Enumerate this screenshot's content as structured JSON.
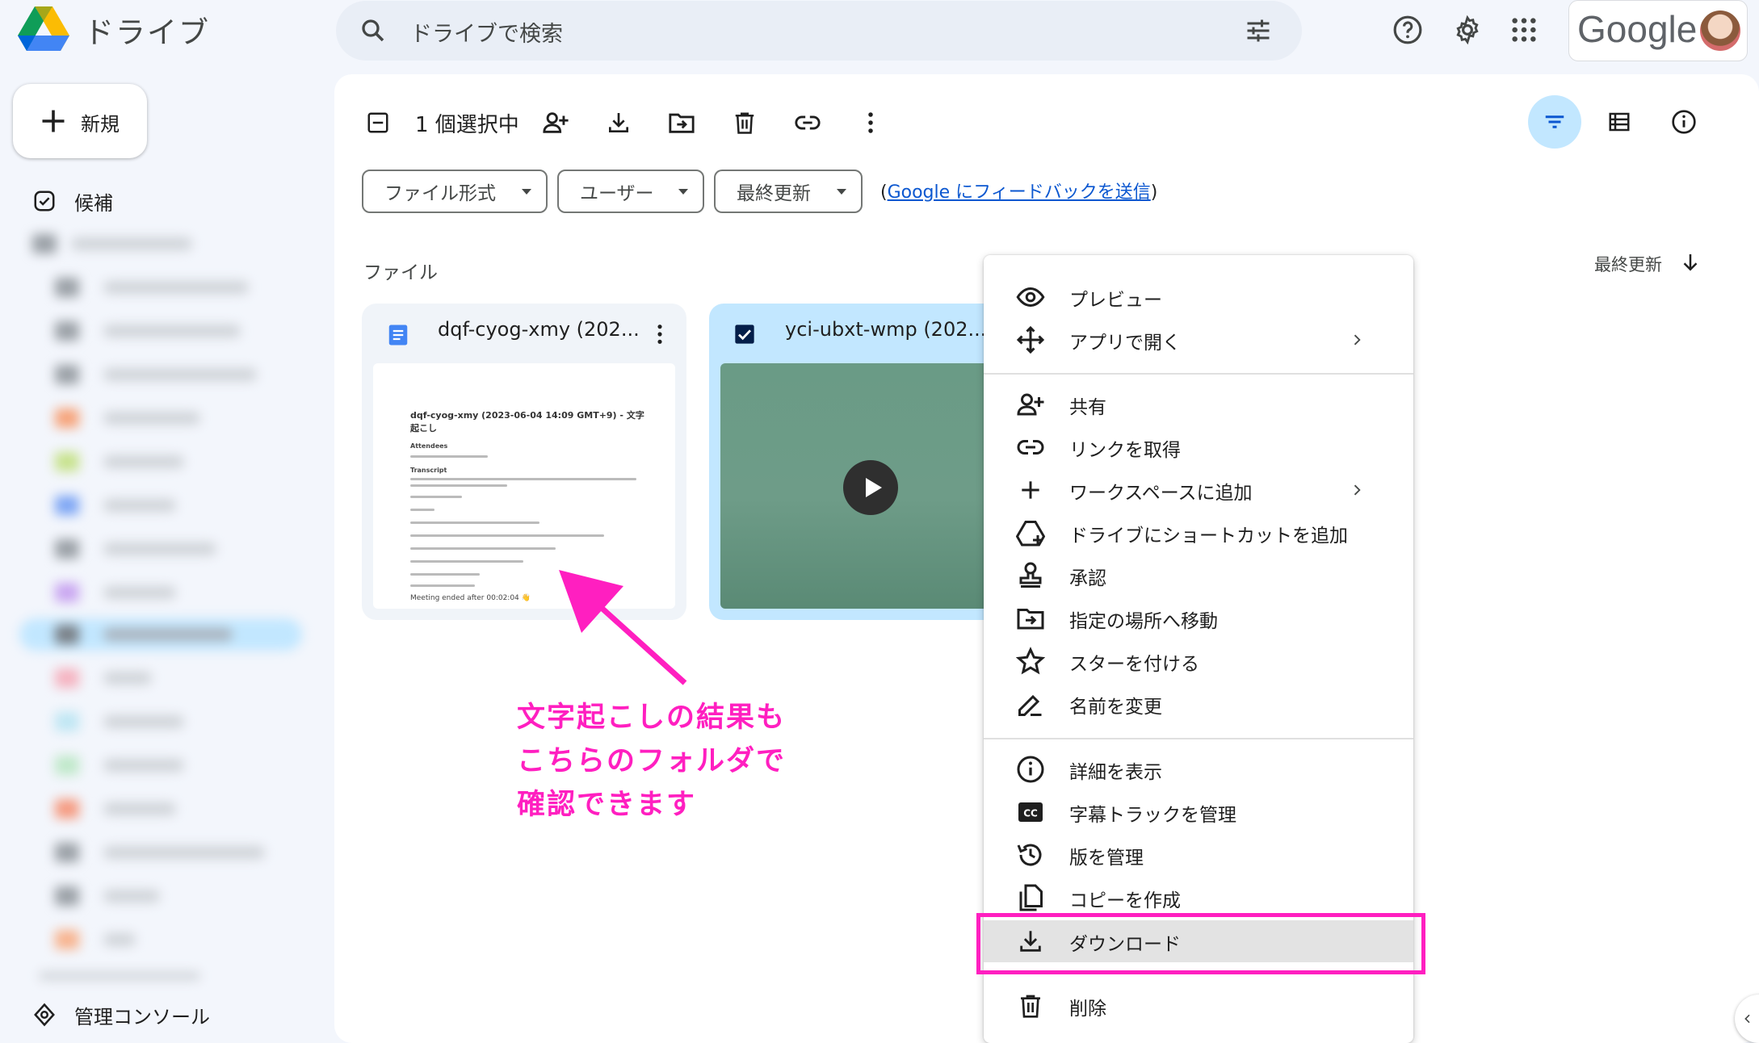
{
  "header": {
    "app_name": "ドライブ",
    "search_placeholder": "ドライブで検索",
    "account_brand": "Google"
  },
  "sidebar": {
    "new_label": "新規",
    "items": [
      {
        "label": "候補",
        "icon": "check-circle-icon"
      }
    ],
    "admin_label": "管理コンソール"
  },
  "toolbar": {
    "selection_text": "1 個選択中"
  },
  "filters": {
    "chips": [
      "ファイル形式",
      "ユーザー",
      "最終更新"
    ],
    "feedback_prefix": "(",
    "feedback_link": "Google にフィードバックを送信",
    "feedback_suffix": ")"
  },
  "files": {
    "section_title": "ファイル",
    "sort_label": "最終更新",
    "items": [
      {
        "name": "dqf-cyog-xmy (202...",
        "type": "document",
        "selected": false
      },
      {
        "name": "yci-ubxt-wmp (202...",
        "type": "video",
        "selected": true
      }
    ],
    "doc_preview": {
      "title": "dqf-cyog-xmy (2023-06-04 14:09 GMT+9) - 文字起こし",
      "attendees_heading": "Attendees",
      "transcript_heading": "Transcript",
      "ending": "Meeting ended after 00:02:04 👋"
    }
  },
  "annotation": {
    "lines": [
      "文字起こしの結果も",
      "こちらのフォルダで",
      "確認できます"
    ],
    "color": "#ff1fc0"
  },
  "context_menu": {
    "groups": [
      [
        {
          "label": "プレビュー",
          "icon": "eye-icon"
        },
        {
          "label": "アプリで開く",
          "icon": "open-with-icon",
          "submenu": true
        }
      ],
      [
        {
          "label": "共有",
          "icon": "person-add-icon"
        },
        {
          "label": "リンクを取得",
          "icon": "link-icon"
        },
        {
          "label": "ワークスペースに追加",
          "icon": "plus-icon",
          "submenu": true
        },
        {
          "label": "ドライブにショートカットを追加",
          "icon": "add-shortcut-icon"
        },
        {
          "label": "承認",
          "icon": "stamp-icon"
        },
        {
          "label": "指定の場所へ移動",
          "icon": "move-folder-icon"
        },
        {
          "label": "スターを付ける",
          "icon": "star-icon"
        },
        {
          "label": "名前を変更",
          "icon": "pencil-icon"
        }
      ],
      [
        {
          "label": "詳細を表示",
          "icon": "info-icon"
        },
        {
          "label": "字幕トラックを管理",
          "icon": "cc-icon"
        },
        {
          "label": "版を管理",
          "icon": "history-icon"
        },
        {
          "label": "コピーを作成",
          "icon": "copy-icon"
        },
        {
          "label": "ダウンロード",
          "icon": "download-icon",
          "highlighted": true
        }
      ],
      [
        {
          "label": "削除",
          "icon": "trash-icon"
        }
      ]
    ]
  },
  "colors": {
    "accent": "#c2e7ff",
    "link": "#0b57d0",
    "highlight_border": "#ff1fc0"
  }
}
